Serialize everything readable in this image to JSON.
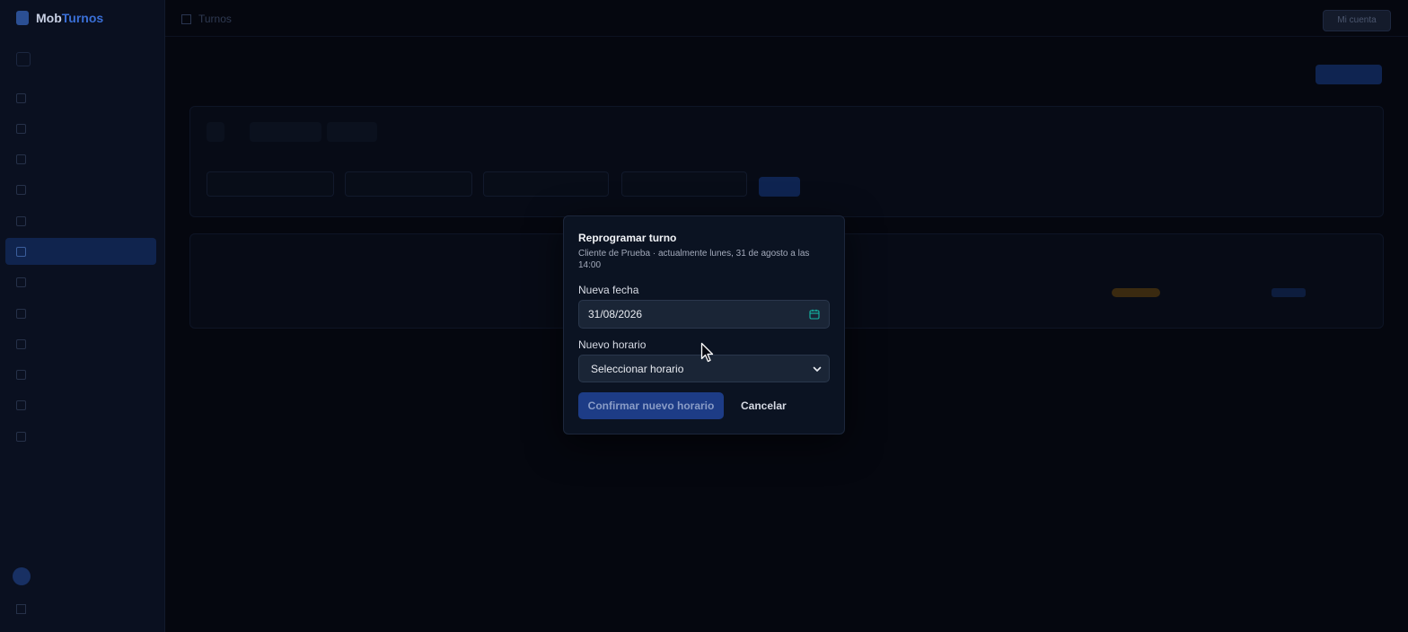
{
  "app": {
    "brand_left": "Mob",
    "brand_right": "Turnos"
  },
  "topbar": {
    "breadcrumb": "Turnos",
    "user_button": "Mi cuenta"
  },
  "modal": {
    "title": "Reprogramar turno",
    "subtitle": "Cliente de Prueba · actualmente lunes, 31 de agosto a las 14:00",
    "date_label": "Nueva fecha",
    "date_value": "31/08/2026",
    "time_label": "Nuevo horario",
    "time_value": "Seleccionar horario",
    "confirm_label": "Confirmar nuevo horario",
    "cancel_label": "Cancelar"
  },
  "colors": {
    "accent": "#1d3c86",
    "calendar_icon": "#14b8a6",
    "overlay": "#05070f"
  },
  "icons": {
    "date": "calendar-icon",
    "select": "chevron-down-icon",
    "cursor": "mouse-pointer-icon"
  }
}
